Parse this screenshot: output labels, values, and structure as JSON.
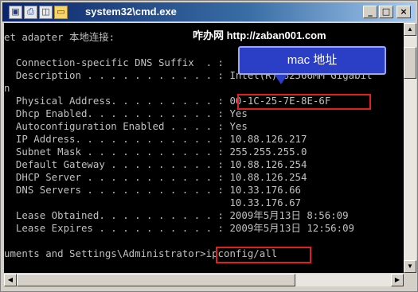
{
  "window": {
    "title": "system32\\cmd.exe",
    "buttons": {
      "minimize": "_",
      "maximize": "□",
      "close": "×"
    },
    "quick_icons": [
      "save-icon",
      "print-icon",
      "preview-icon",
      "folder-icon"
    ]
  },
  "console_lines": [
    "et adapter 本地连接:",
    "",
    "  Connection-specific DNS Suffix  . :",
    "  Description . . . . . . . . . . . : Intel(R) 82566MM Gigabit",
    "n",
    "  Physical Address. . . . . . . . . : 00-1C-25-7E-8E-6F",
    "  Dhcp Enabled. . . . . . . . . . . : Yes",
    "  Autoconfiguration Enabled . . . . : Yes",
    "  IP Address. . . . . . . . . . . . : 10.88.126.217",
    "  Subnet Mask . . . . . . . . . . . : 255.255.255.0",
    "  Default Gateway . . . . . . . . . : 10.88.126.254",
    "  DHCP Server . . . . . . . . . . . : 10.88.126.254",
    "  DNS Servers . . . . . . . . . . . : 10.33.176.66",
    "                                      10.33.176.67",
    "  Lease Obtained. . . . . . . . . . : 2009年5月13日 8:56:09",
    "  Lease Expires . . . . . . . . . . : 2009年5月13日 12:56:09",
    "",
    "uments and Settings\\Administrator>ipconfig/all"
  ],
  "watermark": "咋办网 http://zaban001.com",
  "callout_label": "mac 地址",
  "colors": {
    "console_bg": "#000000",
    "console_text": "#c0c0c0",
    "callout_bg": "#2b3fc6",
    "highlight": "#e02020",
    "titlebar": "#0a246a"
  }
}
